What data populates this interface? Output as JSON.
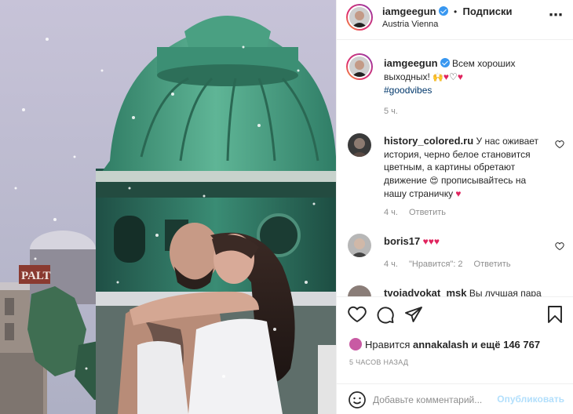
{
  "post_header": {
    "username": "iamgeegun",
    "separator": "•",
    "follow_label": "Подписки",
    "location": "Austria Vienna",
    "more_label": "⋯"
  },
  "caption": {
    "username": "iamgeegun",
    "text": "Всем хороших выходных!",
    "hashtag": "#goodvibes",
    "time": "5 ч."
  },
  "comments": [
    {
      "username": "history_colored.ru",
      "text": "У нас оживает история, черно белое становится цветным, а картины обретают движение",
      "text_end": "прописывайтесь на нашу страничку",
      "time": "4 ч.",
      "reply_label": "Ответить"
    },
    {
      "username": "boris17",
      "time": "4 ч.",
      "likes_label": "\"Нравится\": 2",
      "reply_label": "Ответить"
    },
    {
      "username": "tvoiadvokat_msk",
      "text": "Вы лучшая пара"
    }
  ],
  "likes": {
    "prefix": "Нравится",
    "user": "annakalash",
    "suffix": "и ещё 146 767"
  },
  "date_label": "5 часов назад",
  "composer": {
    "placeholder": "Добавьте комментарий...",
    "publish_label": "Опубликовать"
  },
  "photo": {
    "sign_text": "PALT"
  },
  "colors": {
    "accent_blue": "#3897f0",
    "heart_red": "#e0245e",
    "publish_disabled": "#b2dffc",
    "hashtag": "#00376b"
  },
  "icons": [
    "more-icon",
    "verified-icon",
    "heart-icon",
    "comment-icon",
    "share-icon",
    "bookmark-icon",
    "emoji-icon"
  ]
}
